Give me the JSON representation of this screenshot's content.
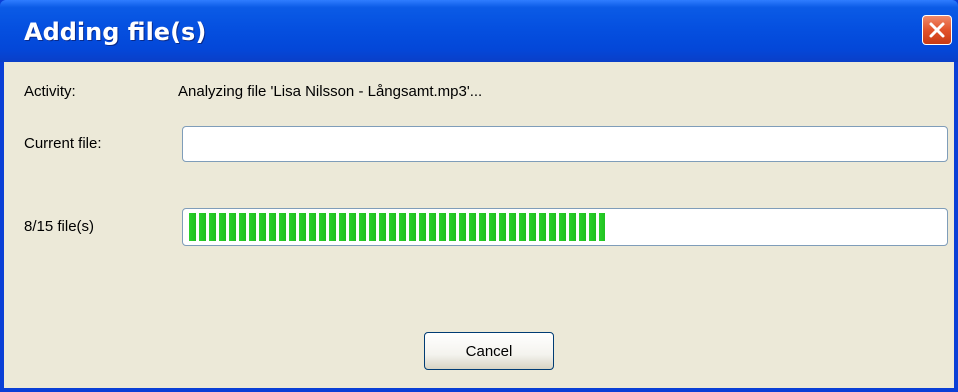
{
  "window": {
    "title": "Adding file(s)"
  },
  "activity": {
    "label": "Activity:",
    "value": "Analyzing file 'Lisa Nilsson - Långsamt.mp3'..."
  },
  "current_file": {
    "label": "Current file:",
    "value": ""
  },
  "progress": {
    "label": "8/15 file(s)",
    "fraction": 0.55
  },
  "buttons": {
    "cancel_label": "Cancel"
  },
  "icons": {
    "close": "close-icon"
  },
  "colors": {
    "titlebar": "#0550e0",
    "client": "#ece9d8",
    "progress_fill": "#2bd12b",
    "close_button": "#e2532b"
  }
}
